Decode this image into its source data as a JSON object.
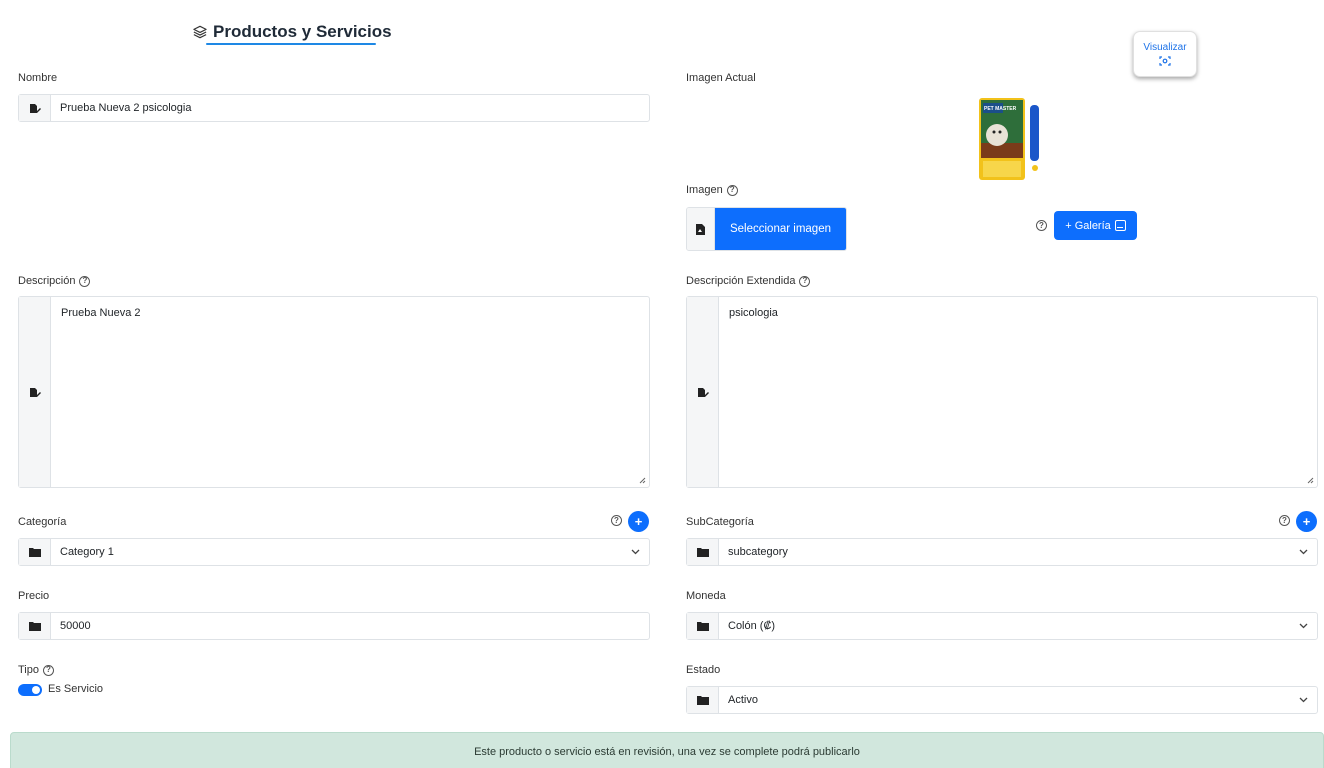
{
  "header": {
    "title": "Productos y Servicios",
    "icon": "layers-icon"
  },
  "preview_button": {
    "label": "Visualizar",
    "icon": "expand-icon"
  },
  "fields": {
    "nombre": {
      "label": "Nombre",
      "value": "Prueba Nueva 2 psicologia",
      "icon": "edit-icon"
    },
    "imagen_actual": {
      "label": "Imagen Actual"
    },
    "imagen": {
      "label": "Imagen",
      "select_button": "Seleccionar imagen",
      "gallery_button": "+ Galería",
      "icon": "file-icon"
    },
    "descripcion": {
      "label": "Descripción",
      "value": "Prueba Nueva 2",
      "icon": "edit-icon"
    },
    "descripcion_extendida": {
      "label": "Descripción Extendida",
      "value": "psicologia",
      "icon": "edit-icon"
    },
    "categoria": {
      "label": "Categoría",
      "value": "Category 1",
      "add_label": "+",
      "icon": "folder-icon"
    },
    "subcategoria": {
      "label": "SubCategoría",
      "value": "subcategory",
      "add_label": "+",
      "icon": "folder-icon"
    },
    "precio": {
      "label": "Precio",
      "value": "50000",
      "icon": "folder-icon"
    },
    "moneda": {
      "label": "Moneda",
      "value": "Colón (₡)",
      "icon": "folder-icon"
    },
    "tipo": {
      "label": "Tipo",
      "toggle_label": "Es Servicio",
      "toggle_on": true
    },
    "estado": {
      "label": "Estado",
      "value": "Activo",
      "icon": "folder-icon"
    }
  },
  "product_image_text": {
    "brand": "PET MASTER"
  },
  "alert": {
    "text": "Este producto o servicio está en revisión, una vez se complete podrá publicarlo"
  },
  "colors": {
    "primary": "#0d6efd",
    "alert_bg": "#d1e7dd",
    "title_underline": "#1e88e5"
  }
}
